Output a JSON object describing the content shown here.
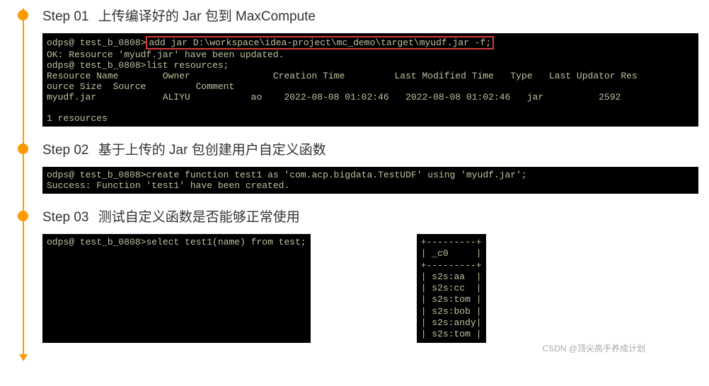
{
  "step1": {
    "label": "Step 01",
    "title": "上传编译好的 Jar 包到 MaxCompute",
    "prompt1": "odps@ test_b_0808>",
    "cmd1": "add jar D:\\workspace\\idea-project\\mc_demo\\target\\myudf.jar -f;",
    "line_ok": "OK: Resource 'myudf.jar' have been updated.",
    "prompt2": "odps@ test_b_0808>",
    "cmd2": "list resources;",
    "header": "Resource Name        Owner               Creation Time         Last Modified Time   Type   Last Updator Res",
    "header2": "ource Size  Source         Comment",
    "row": "myudf.jar            ALIYU           ao    2022-08-08 01:02:46   2022-08-08 01:02:46   jar          2592",
    "footer": "1 resources"
  },
  "step2": {
    "label": "Step 02",
    "title": "基于上传的 Jar 包创建用户自定义函数",
    "prompt": "odps@ test_b_0808>",
    "cmd": "create function test1 as 'com.acp.bigdata.TestUDF' using 'myudf.jar';",
    "result": "Success: Function 'test1' have been created."
  },
  "step3": {
    "label": "Step 03",
    "title": "测试自定义函数是否能够正常使用",
    "prompt": "odps@ test_b_0808>",
    "cmd": "select test1(name) from test;",
    "result_header": "| _c0     |",
    "result_rows": [
      "| s2s:aa  |",
      "| s2s:cc  |",
      "| s2s:tom |",
      "| s2s:bob |",
      "| s2s:andy|",
      "| s2s:tom |"
    ],
    "sep": "+---------+"
  },
  "watermark": "CSDN @顶尖高手养成计划"
}
